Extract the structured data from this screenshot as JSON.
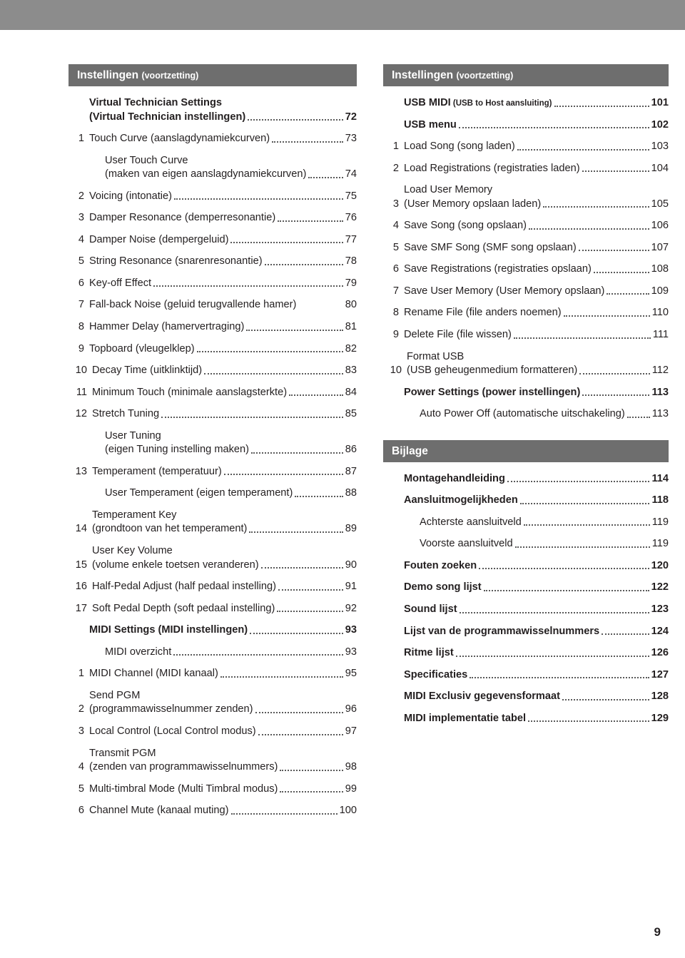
{
  "page_number": "9",
  "left_column": {
    "header": {
      "title": "Instellingen",
      "subtitle": "(voortzetting)"
    },
    "entries": [
      {
        "num": "",
        "label": "Virtual Technician Settings",
        "label2": "(Virtual Technician instellingen)",
        "page": "72",
        "level": 0,
        "dots": true
      },
      {
        "num": "1",
        "label": "Touch Curve (aanslagdynamiekcurven)",
        "label2": "",
        "page": "73",
        "level": 1,
        "dots": true
      },
      {
        "num": "",
        "label": "User Touch Curve",
        "label2": "(maken van eigen aanslagdynamiekcurven)",
        "page": "74",
        "level": 2,
        "dots": true
      },
      {
        "num": "2",
        "label": "Voicing (intonatie)",
        "label2": "",
        "page": "75",
        "level": 1,
        "dots": true
      },
      {
        "num": "3",
        "label": "Damper Resonance (demperresonantie)",
        "label2": "",
        "page": "76",
        "level": 1,
        "dots": true
      },
      {
        "num": "4",
        "label": "Damper Noise (dempergeluid)",
        "label2": "",
        "page": "77",
        "level": 1,
        "dots": true
      },
      {
        "num": "5",
        "label": "String Resonance (snarenresonantie)",
        "label2": "",
        "page": "78",
        "level": 1,
        "dots": true
      },
      {
        "num": "6",
        "label": "Key-off Effect",
        "label2": "",
        "page": "79",
        "level": 1,
        "dots": true
      },
      {
        "num": "7",
        "label": "Fall-back Noise (geluid terugvallende hamer)",
        "label2": "",
        "page": "80",
        "level": 1,
        "dots": false
      },
      {
        "num": "8",
        "label": "Hammer Delay (hamervertraging)",
        "label2": "",
        "page": "81",
        "level": 1,
        "dots": true
      },
      {
        "num": "9",
        "label": "Topboard (vleugelklep)",
        "label2": "",
        "page": "82",
        "level": 1,
        "dots": true
      },
      {
        "num": "10",
        "label": "Decay Time (uitklinktijd)",
        "label2": "",
        "page": "83",
        "level": 1,
        "dots": true
      },
      {
        "num": "11",
        "label": "Minimum Touch (minimale aanslagsterkte)",
        "label2": "",
        "page": "84",
        "level": 1,
        "dots": true
      },
      {
        "num": "12",
        "label": "Stretch Tuning",
        "label2": "",
        "page": "85",
        "level": 1,
        "dots": true
      },
      {
        "num": "",
        "label": "User Tuning",
        "label2": "(eigen Tuning instelling maken)",
        "page": "86",
        "level": 2,
        "dots": true
      },
      {
        "num": "13",
        "label": "Temperament (temperatuur)",
        "label2": "",
        "page": "87",
        "level": 1,
        "dots": true
      },
      {
        "num": "",
        "label": "User Temperament (eigen temperament)",
        "label2": "",
        "page": "88",
        "level": 2,
        "dots": true
      },
      {
        "num": "14",
        "label": "Temperament Key",
        "label2": "(grondtoon van het temperament)",
        "page": "89",
        "level": 1,
        "dots": true
      },
      {
        "num": "15",
        "label": "User Key Volume",
        "label2": "(volume enkele toetsen veranderen)",
        "page": "90",
        "level": 1,
        "dots": true
      },
      {
        "num": "16",
        "label": "Half-Pedal Adjust (half pedaal instelling)",
        "label2": "",
        "page": "91",
        "level": 1,
        "dots": true
      },
      {
        "num": "17",
        "label": "Soft Pedal Depth (soft pedaal instelling)",
        "label2": "",
        "page": "92",
        "level": 1,
        "dots": true
      },
      {
        "num": "",
        "label": "MIDI Settings (MIDI instellingen)",
        "label2": "",
        "page": "93",
        "level": 0,
        "dots": true
      },
      {
        "num": "",
        "label": "MIDI overzicht",
        "label2": "",
        "page": "93",
        "level": 2,
        "dots": true
      },
      {
        "num": "1",
        "label": "MIDI Channel (MIDI kanaal)",
        "label2": "",
        "page": "95",
        "level": 1,
        "dots": true
      },
      {
        "num": "2",
        "label": "Send PGM",
        "label2": "(programmawisselnummer zenden)",
        "page": "96",
        "level": 1,
        "dots": true
      },
      {
        "num": "3",
        "label": "Local Control (Local Control modus)",
        "label2": "",
        "page": "97",
        "level": 1,
        "dots": true
      },
      {
        "num": "4",
        "label": "Transmit PGM",
        "label2": "(zenden van programmawisselnummers)",
        "page": "98",
        "level": 1,
        "dots": true
      },
      {
        "num": "5",
        "label": "Multi-timbral Mode (Multi Timbral modus)",
        "label2": "",
        "page": "99",
        "level": 1,
        "dots": true
      },
      {
        "num": "6",
        "label": "Channel Mute (kanaal muting)",
        "label2": "",
        "page": "100",
        "level": 1,
        "dots": true
      }
    ]
  },
  "right_column": {
    "header": {
      "title": "Instellingen",
      "subtitle": "(voortzetting)"
    },
    "entries": [
      {
        "num": "",
        "label": "USB MIDI",
        "label_small": "(USB to Host aansluiting)",
        "label2": "",
        "page": "101",
        "level": 0,
        "dots": true
      },
      {
        "num": "",
        "label": "USB menu",
        "label_small": "",
        "label2": "",
        "page": "102",
        "level": 0,
        "dots": true
      },
      {
        "num": "1",
        "label": "Load Song (song laden)",
        "label_small": "",
        "label2": "",
        "page": "103",
        "level": 1,
        "dots": true
      },
      {
        "num": "2",
        "label": "Load Registrations (registraties laden)",
        "label_small": "",
        "label2": "",
        "page": "104",
        "level": 1,
        "dots": true
      },
      {
        "num": "3",
        "label": "Load User Memory",
        "label_small": "",
        "label2": "(User Memory opslaan laden)",
        "page": "105",
        "level": 1,
        "dots": true
      },
      {
        "num": "4",
        "label": "Save Song (song opslaan)",
        "label_small": "",
        "label2": "",
        "page": "106",
        "level": 1,
        "dots": true
      },
      {
        "num": "5",
        "label": "Save SMF Song (SMF song opslaan)",
        "label_small": "",
        "label2": "",
        "page": "107",
        "level": 1,
        "dots": true
      },
      {
        "num": "6",
        "label": "Save Registrations (registraties opslaan)",
        "label_small": "",
        "label2": "",
        "page": "108",
        "level": 1,
        "dots": true
      },
      {
        "num": "7",
        "label": "Save User Memory (User Memory opslaan)",
        "label_small": "",
        "label2": "",
        "page": "109",
        "level": 1,
        "dots": true
      },
      {
        "num": "8",
        "label": "Rename File (file anders noemen)",
        "label_small": "",
        "label2": "",
        "page": "110",
        "level": 1,
        "dots": true
      },
      {
        "num": "9",
        "label": "Delete File (file wissen)",
        "label_small": "",
        "label2": "",
        "page": "111",
        "level": 1,
        "dots": true
      },
      {
        "num": "10",
        "label": "Format USB",
        "label_small": "",
        "label2": "(USB geheugenmedium formatteren)",
        "page": "112",
        "level": 1,
        "dots": true
      },
      {
        "num": "",
        "label": "Power Settings (power instellingen)",
        "label_small": "",
        "label2": "",
        "page": "113",
        "level": 0,
        "dots": true
      },
      {
        "num": "",
        "label": "Auto Power Off (automatische uitschakeling)",
        "label_small": "",
        "label2": "",
        "page": "113",
        "level": 2,
        "dots": true
      }
    ],
    "appendix_header": {
      "title": "Bijlage",
      "subtitle": ""
    },
    "appendix_entries": [
      {
        "label": "Montagehandleiding",
        "page": "114"
      },
      {
        "label": "Aansluitmogelijkheden",
        "page": "118"
      },
      {
        "label": "Achterste aansluitveld",
        "page": "119",
        "sub": true
      },
      {
        "label": "Voorste aansluitveld",
        "page": "119",
        "sub": true
      },
      {
        "label": "Fouten zoeken",
        "page": "120"
      },
      {
        "label": "Demo song lijst",
        "page": "122"
      },
      {
        "label": "Sound lijst",
        "page": "123"
      },
      {
        "label": "Lijst van de programmawisselnummers",
        "page": "124"
      },
      {
        "label": "Ritme lijst",
        "page": "126"
      },
      {
        "label": "Specificaties",
        "page": "127"
      },
      {
        "label": "MIDI Exclusiv gegevensformaat",
        "page": "128"
      },
      {
        "label": "MIDI implementatie tabel",
        "page": "129"
      }
    ]
  }
}
